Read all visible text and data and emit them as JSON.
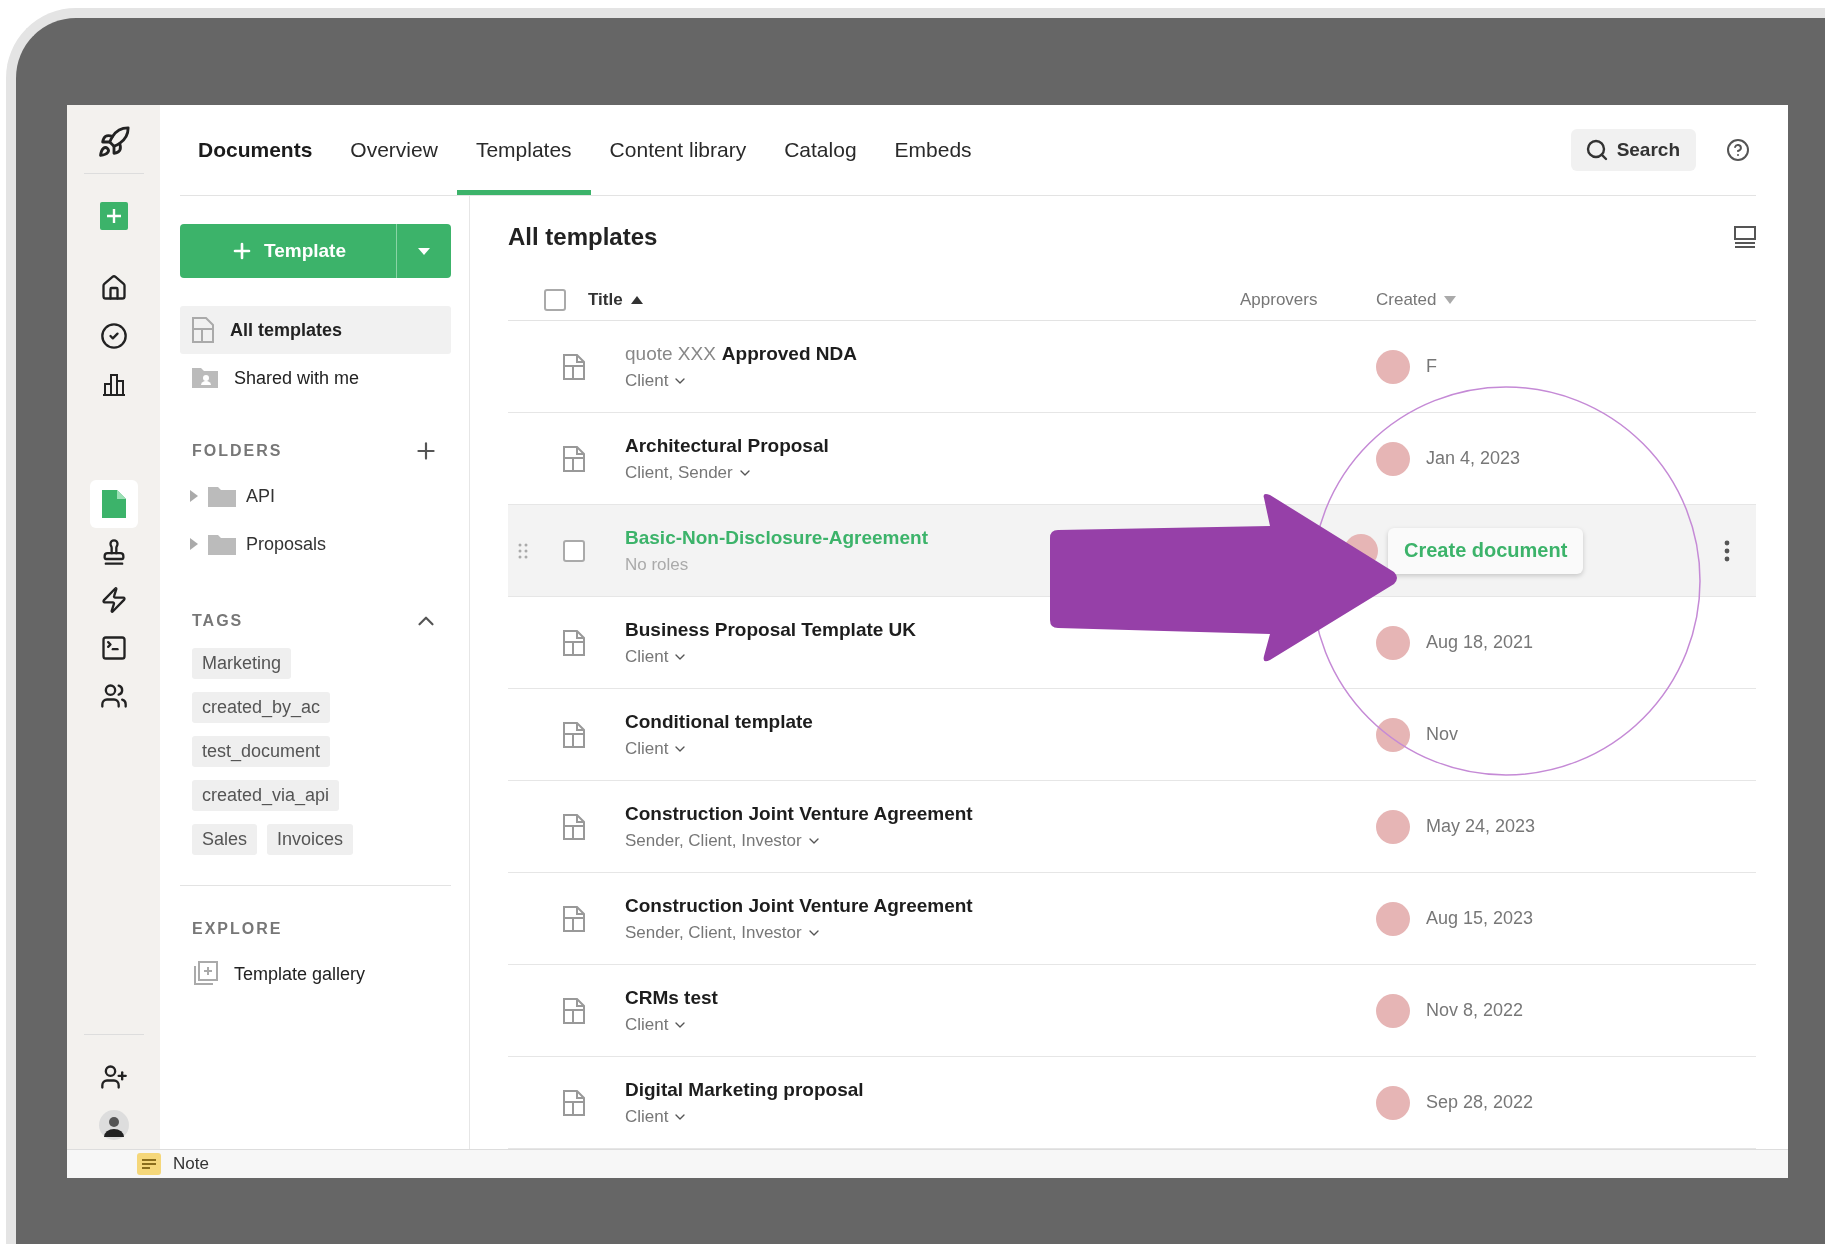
{
  "rail": {
    "items": [
      {
        "kind": "new",
        "selected": false
      },
      {
        "kind": "home",
        "selected": false
      },
      {
        "kind": "tasks",
        "selected": false
      },
      {
        "kind": "reports",
        "selected": false
      },
      {
        "kind": "documents",
        "selected": true
      },
      {
        "kind": "stamp",
        "selected": false
      },
      {
        "kind": "automation",
        "selected": false
      },
      {
        "kind": "forms",
        "selected": false
      },
      {
        "kind": "contacts",
        "selected": false
      }
    ],
    "bottom": [
      {
        "kind": "invite",
        "selected": false
      },
      {
        "kind": "avatar",
        "selected": false
      }
    ]
  },
  "header": {
    "section": "Documents",
    "tabs": [
      {
        "label": "Overview",
        "selected": false
      },
      {
        "label": "Templates",
        "selected": true
      },
      {
        "label": "Content library",
        "selected": false
      },
      {
        "label": "Catalog",
        "selected": false
      },
      {
        "label": "Embeds",
        "selected": false
      }
    ],
    "search": "Search"
  },
  "sidebar": {
    "new_button": "Template",
    "items": [
      {
        "label": "All templates",
        "kind": "templates",
        "selected": true
      },
      {
        "label": "Shared with me",
        "kind": "shared",
        "selected": false
      }
    ],
    "folders": {
      "heading": "FOLDERS",
      "items": [
        {
          "label": "API",
          "expanded": false
        },
        {
          "label": "Proposals",
          "expanded": false
        }
      ]
    },
    "tags": {
      "heading": "TAGS",
      "expanded": true,
      "items": [
        "Marketing",
        "created_by_ac",
        "test_document",
        "created_via_api",
        "Sales",
        "Invoices"
      ]
    },
    "explore": {
      "heading": "EXPLORE",
      "items": [
        "Template gallery"
      ]
    }
  },
  "main": {
    "title": "All templates",
    "select_all": {
      "checked": false
    },
    "columns": [
      {
        "label": "Title",
        "sort_ascending": true
      },
      {
        "label": "Approvers"
      },
      {
        "label": "Created",
        "sort_ascending": false
      }
    ],
    "rows": [
      {
        "prefix": "quote XXX",
        "title": "Approved NDA",
        "roles": "Client",
        "has_menu": true,
        "hovered": false,
        "date": "F"
      },
      {
        "title": "Architectural Proposal",
        "roles": "Client, Sender",
        "has_menu": true,
        "hovered": false,
        "date": "Jan 4, 2023"
      },
      {
        "title": "Basic-Non-Disclosure-Agreement",
        "roles": "No roles",
        "has_menu": false,
        "hovered": true,
        "checked": false,
        "action": "Create document"
      },
      {
        "title": "Business Proposal Template UK",
        "roles": "Client",
        "has_menu": true,
        "hovered": false,
        "date": "Aug 18, 2021"
      },
      {
        "title": "Conditional template",
        "roles": "Client",
        "has_menu": true,
        "hovered": false,
        "date": "Nov"
      },
      {
        "title": "Construction Joint Venture Agreement",
        "roles": "Sender, Client, Investor",
        "has_menu": true,
        "hovered": false,
        "date": "May 24, 2023"
      },
      {
        "title": "Construction Joint Venture Agreement",
        "roles": "Sender, Client, Investor",
        "has_menu": true,
        "hovered": false,
        "date": "Aug 15, 2023"
      },
      {
        "title": "CRMs test",
        "roles": "Client",
        "has_menu": true,
        "hovered": false,
        "date": "Nov 8, 2022"
      },
      {
        "title": "Digital Marketing proposal",
        "roles": "Client",
        "has_menu": true,
        "hovered": false,
        "date": "Sep 28, 2022"
      }
    ]
  },
  "taskbar": {
    "note": "Note"
  }
}
